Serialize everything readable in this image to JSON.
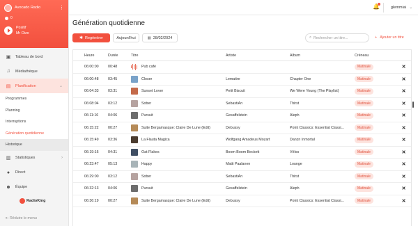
{
  "sidebar": {
    "station_name": "Avocado Radio",
    "listeners": "0",
    "now_playing": {
      "title": "Positif",
      "artist": "Mr Oizo"
    },
    "nav": [
      {
        "id": "dashboard",
        "label": "Tableau de bord",
        "icon": "dashboard-icon"
      },
      {
        "id": "library",
        "label": "Médiathèque",
        "icon": "music-note-icon"
      },
      {
        "id": "planning",
        "label": "Planification",
        "icon": "calendar-icon"
      }
    ],
    "planning_sub": [
      "Programmes",
      "Planning",
      "Interruptions",
      "Génération quotidienne",
      "Historique"
    ],
    "nav_bottom": [
      {
        "id": "stats",
        "label": "Statistiques",
        "icon": "stats-icon"
      },
      {
        "id": "live",
        "label": "Direct",
        "icon": "microphone-icon"
      },
      {
        "id": "team",
        "label": "Équipe",
        "icon": "team-icon"
      }
    ],
    "brand": "RadioKing",
    "collapse_label": "Réduire le menu"
  },
  "topbar": {
    "username": "glemmiai"
  },
  "page": {
    "title": "Génération quotidienne",
    "regen_label": "Regénérer",
    "today_label": "Aujourd'hui",
    "date_value": "28/02/2024",
    "search_placeholder": "Rechercher un titre...",
    "add_label": "Ajouter un titre"
  },
  "table": {
    "headers": [
      "Heure",
      "Durée",
      "Titre",
      "Artiste",
      "Album",
      "Créneau"
    ],
    "rows": [
      {
        "time": "06:00:00",
        "duration": "00:48",
        "title": "Pub café",
        "artist": "",
        "album": "",
        "slot": "Matinale",
        "thumb": "#e8745f"
      },
      {
        "time": "06:00:48",
        "duration": "03:45",
        "title": "Closer",
        "artist": "Lemaitre",
        "album": "Chapter One",
        "slot": "Matinale",
        "thumb": "#7aa3c9"
      },
      {
        "time": "06:04:33",
        "duration": "03:31",
        "title": "Sunset Lover",
        "artist": "Petit Biscuit",
        "album": "We Were Young (The Playlist)",
        "slot": "Matinale",
        "thumb": "#c46a4a"
      },
      {
        "time": "06:08:04",
        "duration": "03:12",
        "title": "Sober",
        "artist": "SebastiAn",
        "album": "Thirst",
        "slot": "Matinale",
        "thumb": "#b6a3a0"
      },
      {
        "time": "06:11:16",
        "duration": "04:06",
        "title": "Pursuit",
        "artist": "Gesaffelstein",
        "album": "Aleph",
        "slot": "Matinale",
        "thumb": "#6d6d6d"
      },
      {
        "time": "06:15:22",
        "duration": "00:27",
        "title": "Suite Bergamasque: Claire De Lune (Edit)",
        "artist": "Debussy",
        "album": "Point Classics: Essential Classi...",
        "slot": "Matinale",
        "thumb": "#b58a57"
      },
      {
        "time": "06:15:49",
        "duration": "03:36",
        "title": "La Flauta Magica",
        "artist": "Wolfgang Amadeus Mozart",
        "album": "Danzn Inmortal",
        "slot": "Matinale",
        "thumb": "#4a3b2e"
      },
      {
        "time": "06:19:16",
        "duration": "04:31",
        "title": "Oat Flakes",
        "artist": "Boom Boom Beckett",
        "album": "Vélos",
        "slot": "Matinale",
        "thumb": "#3f4e63"
      },
      {
        "time": "06:23:47",
        "duration": "05:13",
        "title": "Happy",
        "artist": "Matti Paalanen",
        "album": "Lounge",
        "slot": "Matinale",
        "thumb": "#a8b4b8"
      },
      {
        "time": "06:29:00",
        "duration": "03:12",
        "title": "Sober",
        "artist": "SebastiAn",
        "album": "Thirst",
        "slot": "Matinale",
        "thumb": "#b6a3a0"
      },
      {
        "time": "06:32:13",
        "duration": "04:06",
        "title": "Pursuit",
        "artist": "Gesaffelstein",
        "album": "Aleph",
        "slot": "Matinale",
        "thumb": "#6d6d6d"
      },
      {
        "time": "06:36:19",
        "duration": "00:27",
        "title": "Suite Bergamasque: Claire De Lune (Edit)",
        "artist": "Debussy",
        "album": "Point Classics: Essential Classi...",
        "slot": "Matinale",
        "thumb": "#b58a57"
      }
    ]
  },
  "colors": {
    "accent": "#f2503e",
    "pill_bg": "#fde3de"
  }
}
